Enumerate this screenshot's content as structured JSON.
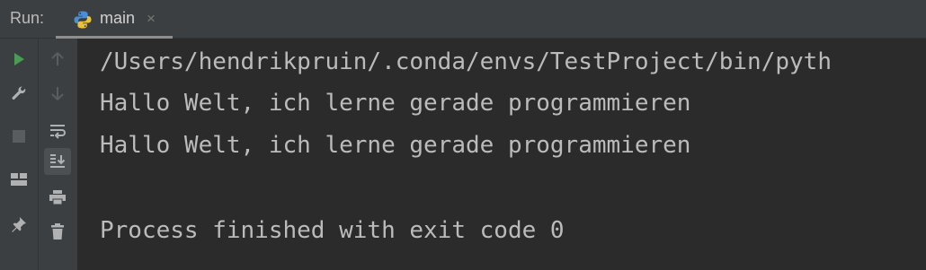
{
  "header": {
    "run_label": "Run:",
    "tab": {
      "label": "main",
      "close": "×",
      "icon": "python-icon"
    }
  },
  "toolbar_left": [
    {
      "name": "run-icon",
      "color": "#499c54"
    },
    {
      "name": "wrench-icon",
      "color": "#afb1b3"
    },
    {
      "name": "stop-icon",
      "color": "#5a5d5f"
    },
    {
      "name": "layout-icon",
      "color": "#afb1b3"
    },
    {
      "name": "pin-icon",
      "color": "#afb1b3"
    }
  ],
  "toolbar_right": [
    {
      "name": "up-arrow-icon",
      "color": "#5a5d5f"
    },
    {
      "name": "down-arrow-icon",
      "color": "#5a5d5f"
    },
    {
      "name": "soft-wrap-icon",
      "color": "#afb1b3"
    },
    {
      "name": "scroll-to-end-icon",
      "color": "#afb1b3",
      "active": true
    },
    {
      "name": "print-icon",
      "color": "#afb1b3"
    },
    {
      "name": "trash-icon",
      "color": "#afb1b3"
    }
  ],
  "console": {
    "lines": [
      "/Users/hendrikpruin/.conda/envs/TestProject/bin/pyth",
      "Hallo Welt, ich lerne gerade programmieren",
      "Hallo Welt, ich lerne gerade programmieren",
      "",
      "Process finished with exit code 0"
    ]
  }
}
